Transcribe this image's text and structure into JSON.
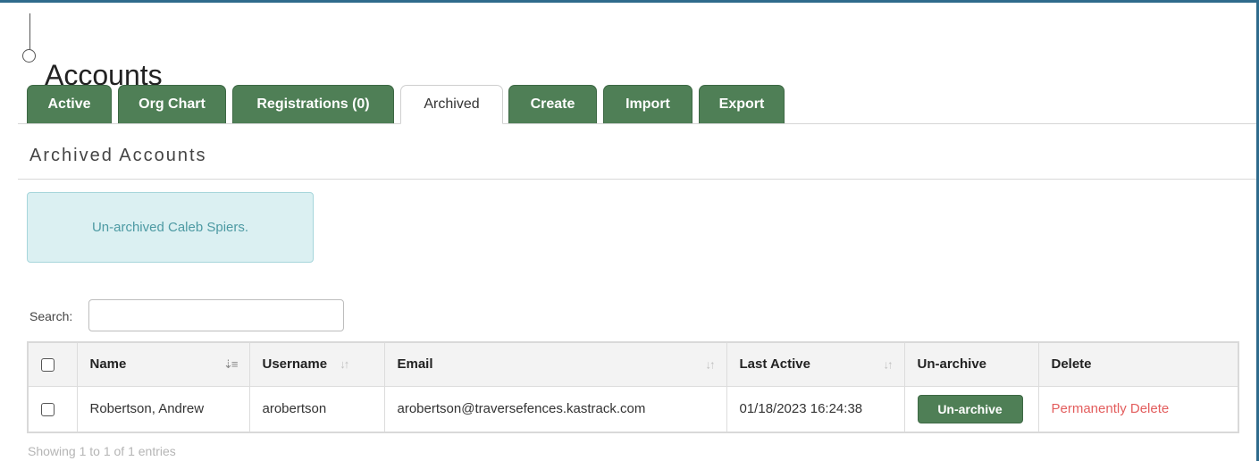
{
  "page": {
    "title": "Accounts"
  },
  "tabs": [
    {
      "label": "Active",
      "active": false
    },
    {
      "label": "Org Chart",
      "active": false
    },
    {
      "label": "Registrations (0)",
      "active": false
    },
    {
      "label": "Archived",
      "active": true
    },
    {
      "label": "Create",
      "active": false
    },
    {
      "label": "Import",
      "active": false
    },
    {
      "label": "Export",
      "active": false
    }
  ],
  "section": {
    "title": "Archived Accounts"
  },
  "alert": {
    "message": "Un-archived Caleb Spiers."
  },
  "search": {
    "label": "Search:",
    "value": ""
  },
  "table": {
    "headers": {
      "name": "Name",
      "username": "Username",
      "email": "Email",
      "last_active": "Last Active",
      "unarchive": "Un-archive",
      "delete": "Delete"
    },
    "rows": [
      {
        "name": "Robertson, Andrew",
        "username": "arobertson",
        "email": "arobertson@traversefences.kastrack.com",
        "last_active": "01/18/2023 16:24:38",
        "unarchive_label": "Un-archive",
        "delete_label": "Permanently Delete"
      }
    ],
    "info": "Showing 1 to 1 of 1 entries"
  },
  "icons": {
    "sort_active": "sort-amount-down-icon",
    "sort": "sort-icon"
  },
  "colors": {
    "tab_green": "#4f7f56",
    "frame_blue": "#2f6b8c",
    "alert_bg": "#dbf0f2",
    "alert_text": "#4d9aa3",
    "delete_red": "#e35d5d"
  }
}
